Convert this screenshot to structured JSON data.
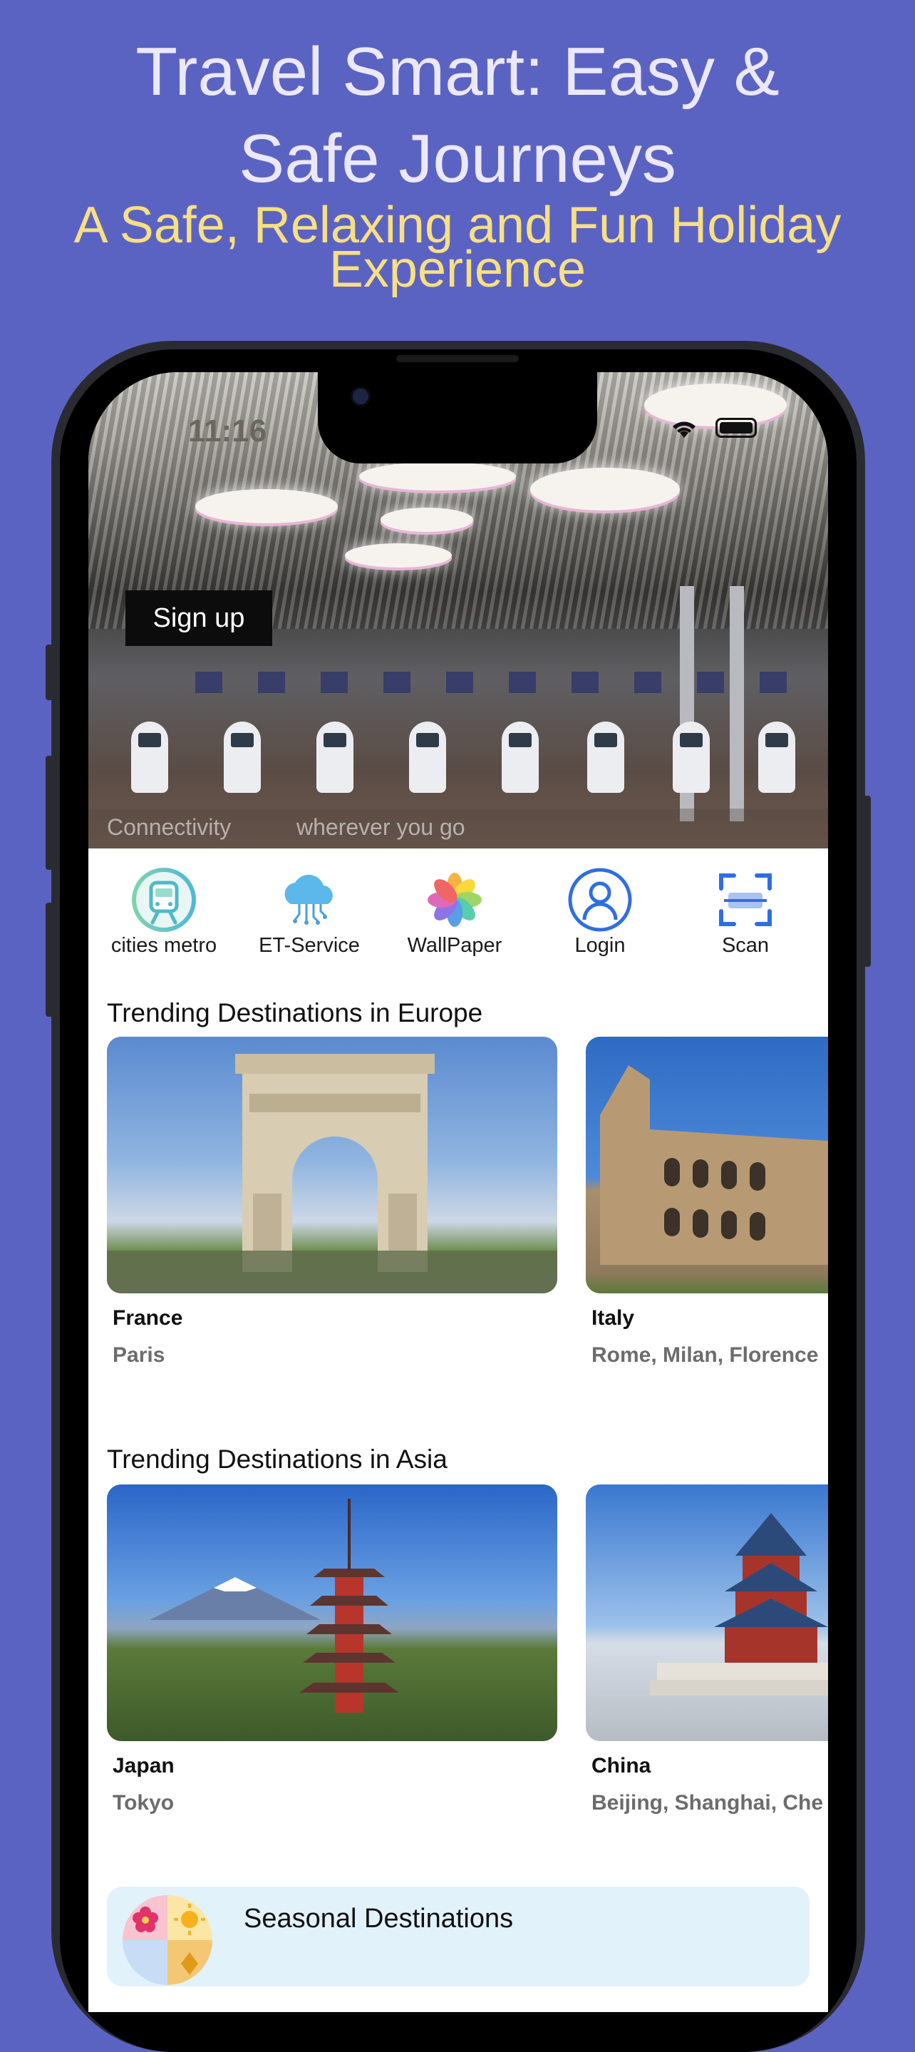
{
  "promo": {
    "headline": "Travel Smart: Easy &\nSafe Journeys",
    "subline": "A Safe, Relaxing and Fun Holiday\nExperience"
  },
  "status_bar": {
    "time": "11:16"
  },
  "hero": {
    "signup_label": "Sign up",
    "caption_left": "Connectivity",
    "caption_right": "wherever you go"
  },
  "quick_actions": [
    {
      "label": "cities metro",
      "icon": "metro-train-icon"
    },
    {
      "label": "ET-Service",
      "icon": "cloud-service-icon"
    },
    {
      "label": "WallPaper",
      "icon": "photos-flower-icon"
    },
    {
      "label": "Login",
      "icon": "user-login-icon"
    },
    {
      "label": "Scan",
      "icon": "scan-icon"
    }
  ],
  "europe": {
    "title": "Trending Destinations in Europe",
    "items": [
      {
        "country": "France",
        "cities": "Paris"
      },
      {
        "country": "Italy",
        "cities": "Rome, Milan, Florence"
      }
    ]
  },
  "asia": {
    "title": "Trending Destinations in Asia",
    "items": [
      {
        "country": "Japan",
        "cities": "Tokyo"
      },
      {
        "country": "China",
        "cities": "Beijing, Shanghai, Che"
      }
    ]
  },
  "seasonal": {
    "label": "Seasonal Destinations"
  },
  "colors": {
    "background": "#5b63c2",
    "headline": "#ece8fb",
    "subline": "#f7df84",
    "seasonal_bg": "#e2f2fb"
  }
}
